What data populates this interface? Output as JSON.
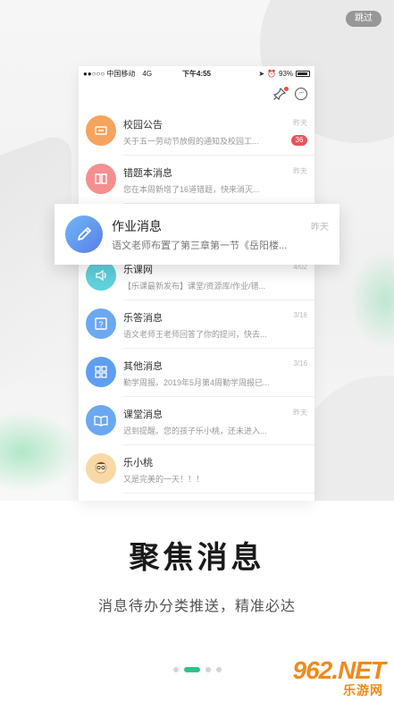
{
  "skip_label": "跳过",
  "status_bar": {
    "carrier": "●●○○○ 中国移动",
    "network": "4G",
    "time": "下午4:55",
    "battery": "93%"
  },
  "messages": [
    {
      "title": "校园公告",
      "preview": "关于五一劳动节放假的通知及校园工...",
      "time": "昨天",
      "badge": "36",
      "color": "#f6a35d",
      "icon": "notice-icon"
    },
    {
      "title": "错题本消息",
      "preview": "您在本周新增了16道错题，快来消灭...",
      "time": "昨天",
      "color": "#f48f8f",
      "icon": "book-icon"
    },
    {
      "title": "作业消息",
      "preview": "",
      "time": "",
      "color": "#6db8f6",
      "icon": "pencil-icon"
    },
    {
      "title": "乐课网",
      "preview": "【乐课最新发布】课堂/资源库/作业/错...",
      "time": "4/02",
      "color": "#5fd0dc",
      "icon": "speaker-icon"
    },
    {
      "title": "乐答消息",
      "preview": "语文老师王老师回答了你的提问，快去...",
      "time": "3/16",
      "color": "#6aa8f2",
      "icon": "question-icon"
    },
    {
      "title": "其他消息",
      "preview": "勤学周报。2019年5月第4周勤学周报已...",
      "time": "3/16",
      "color": "#5f9df0",
      "icon": "grid-icon"
    },
    {
      "title": "课堂消息",
      "preview": "迟到提醒。您的孩子乐小桃，还未进入...",
      "time": "昨天",
      "color": "#6aa8f2",
      "icon": "open-book-icon"
    },
    {
      "title": "乐小桃",
      "preview": "又是完美的一天！！！",
      "time": "",
      "color": "#f7d9a8",
      "icon": "avatar-icon"
    }
  ],
  "focus_card": {
    "title": "作业消息",
    "preview": "语文老师布置了第三章第一节《岳阳楼...",
    "time": "昨天"
  },
  "headline": "聚焦消息",
  "subline": "消息待办分类推送，精准必达",
  "pagination": {
    "total": 4,
    "active": 1
  },
  "watermark": {
    "main": "962.NET",
    "sub": "乐游网"
  },
  "accent_color": "#2fc48a"
}
